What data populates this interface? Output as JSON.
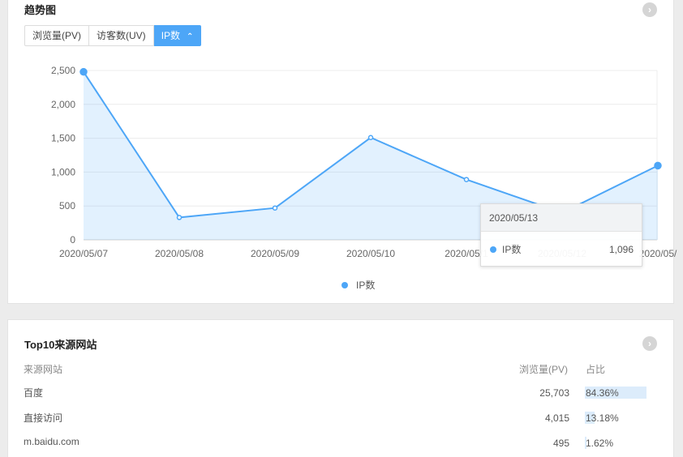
{
  "trend": {
    "title": "趋势图",
    "tabs": [
      {
        "label": "浏览量(PV)",
        "active": false
      },
      {
        "label": "访客数(UV)",
        "active": false
      },
      {
        "label": "IP数",
        "active": true
      }
    ],
    "active_tab_caret": "^",
    "more_icon": "chevron-right-icon",
    "tooltip": {
      "date": "2020/05/13",
      "series": "IP数",
      "value": "1,096"
    },
    "legend": "IP数"
  },
  "chart_data": {
    "type": "area",
    "x": [
      "2020/05/07",
      "2020/05/08",
      "2020/05/09",
      "2020/05/10",
      "2020/05/11",
      "2020/05/12",
      "2020/05/13"
    ],
    "x_tick_labels": [
      "2020/05/07",
      "2020/05/08",
      "2020/05/09",
      "2020/05/10",
      "2020/05/1",
      "2020/05/12",
      "2020/05/"
    ],
    "series": [
      {
        "name": "IP数",
        "values": [
          2480,
          330,
          470,
          1510,
          890,
          400,
          1096
        ]
      }
    ],
    "yticks": [
      "0",
      "500",
      "1,000",
      "1,500",
      "2,000",
      "2,500"
    ],
    "ylim": [
      0,
      2500
    ],
    "grid": true,
    "legend_position": "bottom-center",
    "color": "#4da6f7"
  },
  "top10": {
    "title": "Top10来源网站",
    "more_icon": "chevron-right-icon",
    "headers": {
      "site": "来源网站",
      "pv": "浏览量(PV)",
      "ratio": "占比"
    },
    "rows": [
      {
        "site": "百度",
        "pv": "25,703",
        "ratio": "84.36%",
        "ratio_value": 0.8436
      },
      {
        "site": "直接访问",
        "pv": "4,015",
        "ratio": "13.18%",
        "ratio_value": 0.1318
      },
      {
        "site": "m.baidu.com",
        "pv": "495",
        "ratio": "1.62%",
        "ratio_value": 0.0162
      }
    ]
  }
}
